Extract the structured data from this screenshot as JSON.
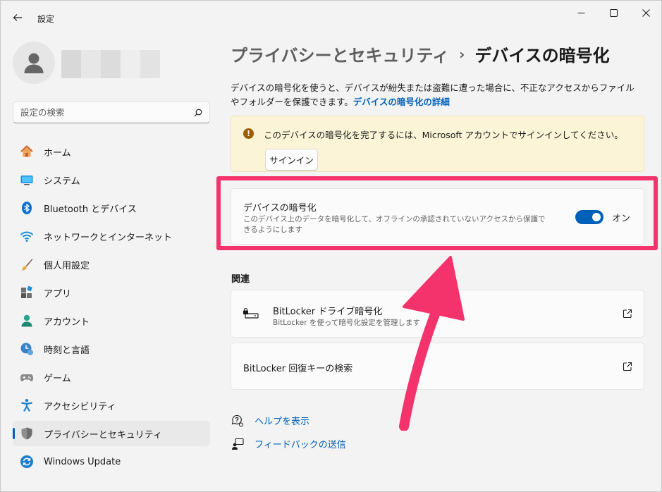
{
  "window": {
    "title": "設定"
  },
  "sidebar": {
    "search_placeholder": "設定の検索",
    "items": [
      {
        "label": "ホーム",
        "icon": "home-icon"
      },
      {
        "label": "システム",
        "icon": "system-icon"
      },
      {
        "label": "Bluetooth とデバイス",
        "icon": "bluetooth-icon"
      },
      {
        "label": "ネットワークとインターネット",
        "icon": "wifi-icon"
      },
      {
        "label": "個人用設定",
        "icon": "brush-icon"
      },
      {
        "label": "アプリ",
        "icon": "apps-icon"
      },
      {
        "label": "アカウント",
        "icon": "account-icon"
      },
      {
        "label": "時刻と言語",
        "icon": "time-language-icon"
      },
      {
        "label": "ゲーム",
        "icon": "gamepad-icon"
      },
      {
        "label": "アクセシビリティ",
        "icon": "accessibility-icon"
      },
      {
        "label": "プライバシーとセキュリティ",
        "icon": "shield-icon",
        "active": true
      },
      {
        "label": "Windows Update",
        "icon": "update-icon"
      }
    ]
  },
  "breadcrumb": {
    "parent": "プライバシーとセキュリティ",
    "separator": "›",
    "current": "デバイスの暗号化"
  },
  "description": {
    "text": "デバイスの暗号化を使うと、デバイスが紛失または盗難に遭った場合に、不正なアクセスからファイルやフォルダーを保護できます。",
    "link": "デバイスの暗号化の詳細"
  },
  "warning": {
    "text": "このデバイスの暗号化を完了するには、Microsoft アカウントでサインインしてください。",
    "button": "サインイン",
    "icon_symbol": "!"
  },
  "encryption": {
    "title": "デバイスの暗号化",
    "subtitle": "このデバイス上のデータを暗号化して、オフラインの承認されていないアクセスから保護できるようにします",
    "toggle_on": true,
    "toggle_label": "オン"
  },
  "related": {
    "heading": "関連",
    "cards": [
      {
        "title": "BitLocker ドライブ暗号化",
        "subtitle": "BitLocker を使って暗号化設定を管理します"
      },
      {
        "title": "BitLocker 回復キーの検索"
      }
    ]
  },
  "help": {
    "get_help": "ヘルプを表示",
    "feedback": "フィードバックの送信"
  },
  "colors": {
    "accent": "#005fb8",
    "highlight": "#f4326c",
    "warning_bg": "#fcf4d6"
  }
}
